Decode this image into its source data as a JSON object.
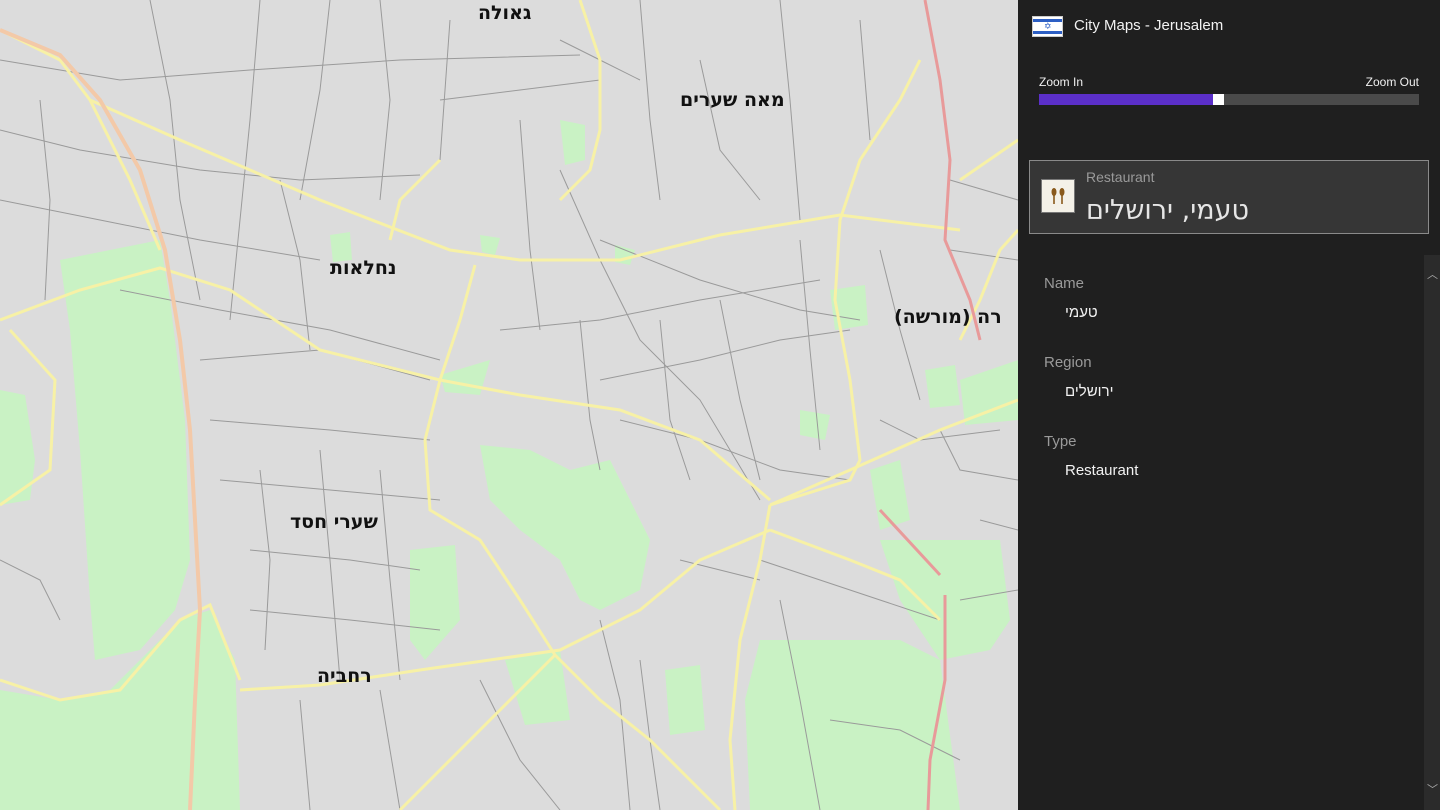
{
  "map": {
    "labels": [
      {
        "text": "גאולה"
      },
      {
        "text": "מאה שערים"
      },
      {
        "text": "נחלאות"
      },
      {
        "text": "רה (מורשה)"
      },
      {
        "text": "שערי חסד"
      },
      {
        "text": "רחביה"
      }
    ],
    "colors": {
      "background": "#dcdcdc",
      "street": "#9a9a9a",
      "major_road": "#f7f1a6",
      "highway": "#e89a9a",
      "park": "#c9f2c4"
    }
  },
  "panel": {
    "app_title": "City Maps - Jerusalem",
    "flag_icon": "israel-flag-icon",
    "zoom": {
      "in_label": "Zoom In",
      "out_label": "Zoom Out",
      "level_percent": 47
    },
    "poi": {
      "type": "Restaurant",
      "name": "טעמי, ירושלים",
      "icon": "restaurant-icon"
    },
    "details": [
      {
        "label": "Name",
        "value": "טעמי"
      },
      {
        "label": "Region",
        "value": "ירושלים"
      },
      {
        "label": "Type",
        "value": "Restaurant"
      }
    ],
    "colors": {
      "background": "#1f1f1f",
      "accent": "#5b2fc9",
      "card": "#363636"
    }
  }
}
